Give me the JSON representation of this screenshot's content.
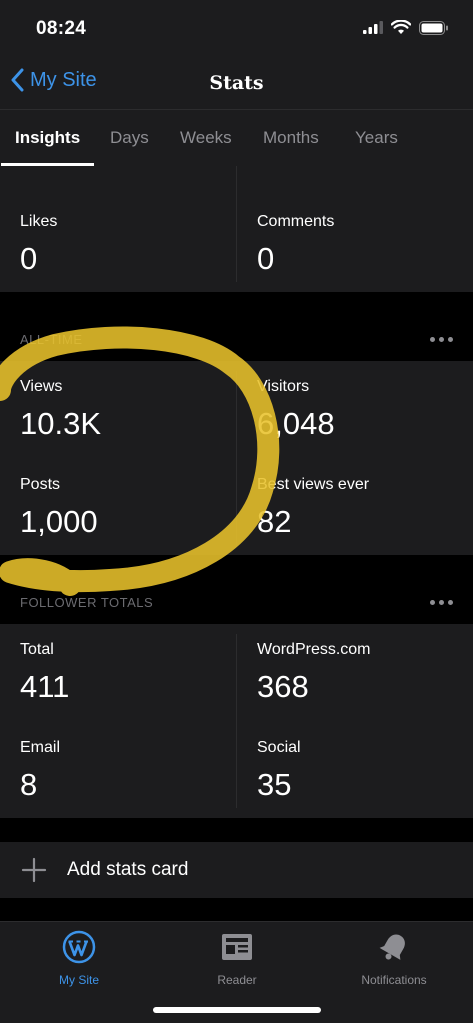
{
  "status_bar": {
    "time": "08:24"
  },
  "nav": {
    "back_label": "My Site",
    "title": "Stats"
  },
  "tabs": [
    {
      "label": "Insights",
      "active": true
    },
    {
      "label": "Days",
      "active": false
    },
    {
      "label": "Weeks",
      "active": false
    },
    {
      "label": "Months",
      "active": false
    },
    {
      "label": "Years",
      "active": false
    }
  ],
  "top_card": {
    "likes_label": "Likes",
    "likes_value": "0",
    "comments_label": "Comments",
    "comments_value": "0"
  },
  "all_time": {
    "title": "ALL-TIME",
    "views_label": "Views",
    "views_value": "10.3K",
    "visitors_label": "Visitors",
    "visitors_value": "6,048",
    "posts_label": "Posts",
    "posts_value": "1,000",
    "best_label": "Best views ever",
    "best_value": "82"
  },
  "followers": {
    "title": "FOLLOWER TOTALS",
    "total_label": "Total",
    "total_value": "411",
    "wpcom_label": "WordPress.com",
    "wpcom_value": "368",
    "email_label": "Email",
    "email_value": "8",
    "social_label": "Social",
    "social_value": "35"
  },
  "add_card": {
    "icon": "plus-icon",
    "label": "Add stats card"
  },
  "tab_bar": [
    {
      "label": "My Site",
      "icon": "wordpress-icon",
      "active": true
    },
    {
      "label": "Reader",
      "icon": "reader-icon",
      "active": false
    },
    {
      "label": "Notifications",
      "icon": "bell-icon",
      "active": false
    }
  ],
  "colors": {
    "accent": "#3d93e8",
    "highlight": "#e8c22b",
    "card": "#1c1c1e",
    "background": "#000000"
  }
}
